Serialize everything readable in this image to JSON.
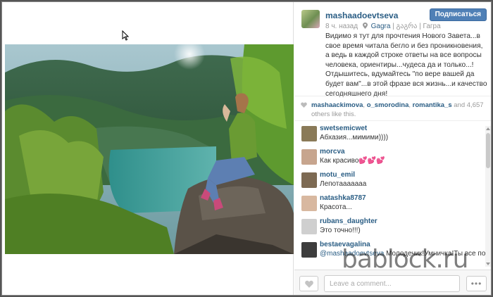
{
  "post": {
    "username": "mashaadoevtseva",
    "follow_label": "Подписаться",
    "time": "8 ч. назад",
    "location": "Gagra",
    "location_extra": "| გაგრა | Гагра",
    "caption": "Видимо я тут для прочтения Нового Завета...в свое время читала бегло и без проникновения, а ведь в каждой строке ответы на все вопросы человека, ориентиры...чудеса да и только...! Отдышитесь, вдумайтесь \"по вере вашей да будет вам\"...в этой фразе вся жизнь...и качество сегодняшнего дня!"
  },
  "likes": {
    "user1": "mashaackimova",
    "sep1": ", ",
    "user2": "o_smorodina",
    "sep2": ", ",
    "user3": "romantika_s",
    "and_text": " and ",
    "count": "4,657",
    "others_text": " others like this."
  },
  "comments": [
    {
      "user": "swetsemicwet",
      "text": "Абхазия...мимими))))",
      "color": "#8a7a58"
    },
    {
      "user": "morcva",
      "text": "Как красиво💕💕💕",
      "color": "#c7a58e"
    },
    {
      "user": "motu_emil",
      "text": "Лепотааааааа",
      "color": "#7d6a53"
    },
    {
      "user": "natashka8787",
      "text": "Красота...",
      "color": "#d8b8a0"
    },
    {
      "user": "rubans_daughter",
      "text": "Это точно!!!)",
      "color": "#cfcfcf"
    },
    {
      "user": "bestaevagalina",
      "mention": "@mashaadoevtseva",
      "text": " Молодечик!Умничка!Ты все поймешь!Только не бросай!♥♥♥",
      "color": "#3d3d3d"
    }
  ],
  "footer": {
    "comment_placeholder": "Leave a comment...",
    "more_label": "•••"
  },
  "watermark": "bablock.ru",
  "colors": {
    "link": "#2a5d84",
    "follow_button": "#4f80b6"
  }
}
